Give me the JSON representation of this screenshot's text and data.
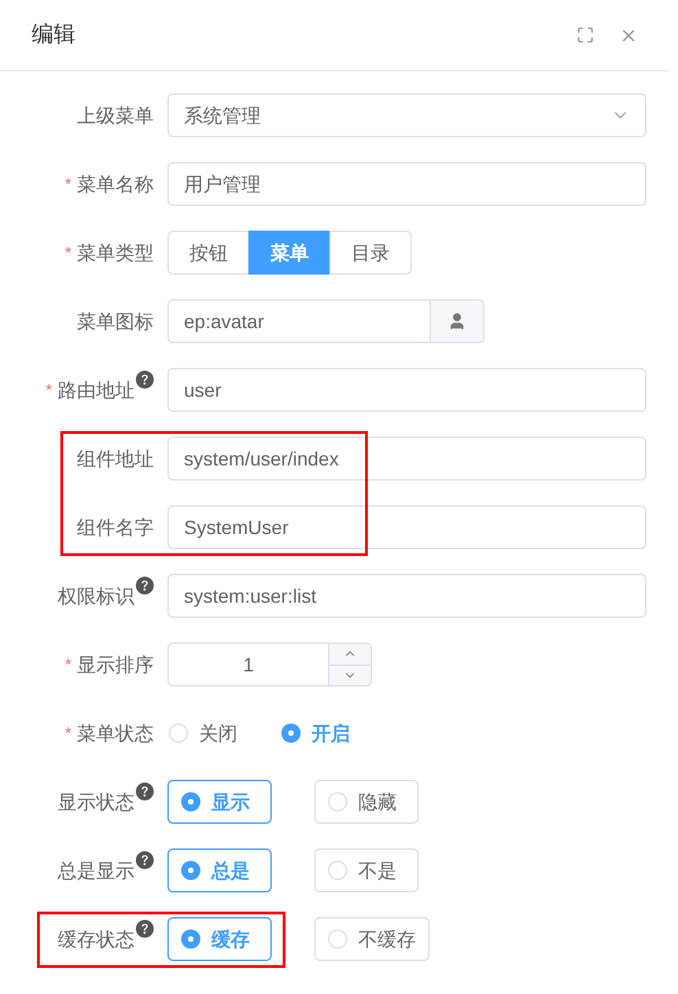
{
  "dialog": {
    "title": "编辑"
  },
  "form": {
    "rows": [
      {
        "kind": "select",
        "label": "上级菜单",
        "help": false,
        "highlighted": false,
        "value": "系统管理"
      },
      {
        "kind": "input",
        "required_mark": "*",
        "label": "菜单名称",
        "help": false,
        "highlighted": false,
        "value": "用户管理"
      },
      {
        "kind": "segmented",
        "required_mark": "*",
        "label": "菜单类型",
        "help": false,
        "highlighted": false,
        "options": [
          {
            "label": "按钮",
            "selected": false
          },
          {
            "label": "菜单",
            "selected": true
          },
          {
            "label": "目录",
            "selected": false
          }
        ]
      },
      {
        "kind": "icon-input",
        "label": "菜单图标",
        "help": false,
        "highlighted": false,
        "value": "ep:avatar"
      },
      {
        "kind": "input",
        "required_mark": "*",
        "label": "路由地址",
        "help": true,
        "highlighted": false,
        "value": "user"
      },
      {
        "kind": "input",
        "label": "组件地址",
        "help": false,
        "highlighted": true,
        "value": "system/user/index"
      },
      {
        "kind": "input",
        "label": "组件名字",
        "help": false,
        "highlighted": true,
        "value": "SystemUser"
      },
      {
        "kind": "input",
        "label": "权限标识",
        "help": true,
        "highlighted": false,
        "value": "system:user:list"
      },
      {
        "kind": "number",
        "required_mark": "*",
        "label": "显示排序",
        "help": false,
        "highlighted": false,
        "value": "1"
      },
      {
        "kind": "radio",
        "required_mark": "*",
        "label": "菜单状态",
        "help": false,
        "highlighted": false,
        "options": [
          {
            "label": "关闭",
            "selected": false
          },
          {
            "label": "开启",
            "selected": true
          }
        ]
      },
      {
        "kind": "radio-border",
        "label": "显示状态",
        "help": true,
        "highlighted": false,
        "options": [
          {
            "label": "显示",
            "selected": true
          },
          {
            "label": "隐藏",
            "selected": false
          }
        ]
      },
      {
        "kind": "radio-border",
        "label": "总是显示",
        "help": true,
        "highlighted": false,
        "options": [
          {
            "label": "总是",
            "selected": true
          },
          {
            "label": "不是",
            "selected": false
          }
        ]
      },
      {
        "kind": "radio-border",
        "label": "缓存状态",
        "help": true,
        "highlighted": true,
        "options": [
          {
            "label": "缓存",
            "selected": true
          },
          {
            "label": "不缓存",
            "selected": false
          }
        ]
      }
    ]
  }
}
